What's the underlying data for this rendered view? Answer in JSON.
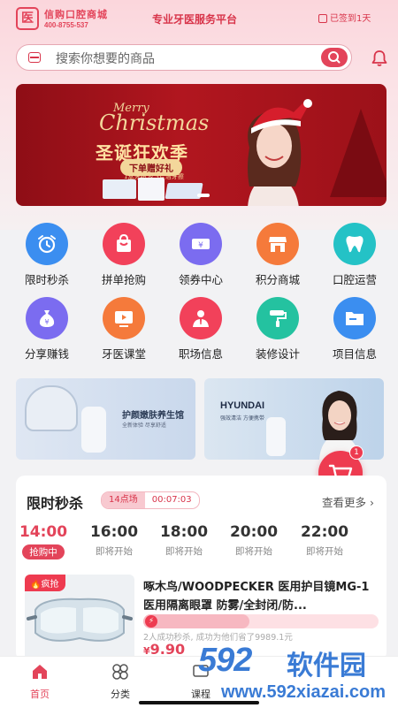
{
  "header": {
    "logo_name": "信购口腔商城",
    "logo_mark": "医",
    "logo_phone": "400-8755-537",
    "platform_title": "专业牙医服务平台",
    "signin_text": "已签到1天"
  },
  "search": {
    "placeholder": "搜索你想要的商品"
  },
  "banner": {
    "merry": "Merry",
    "christmas": "Christmas",
    "headline": "圣诞狂欢季",
    "gift": "下单赠好礼",
    "gift_desc": "1盒牙粉 & 5片洁牙擦"
  },
  "grid": {
    "row1": [
      {
        "label": "限时秒杀",
        "color": "#3b8ef0",
        "icon": "alarm-clock-icon"
      },
      {
        "label": "拼单抢购",
        "color": "#f2415a",
        "icon": "shopping-bag-icon"
      },
      {
        "label": "领券中心",
        "color": "#7b6cf0",
        "icon": "coupon-icon"
      },
      {
        "label": "积分商城",
        "color": "#f57a3b",
        "icon": "store-icon"
      },
      {
        "label": "口腔运营",
        "color": "#24c2c6",
        "icon": "tooth-icon"
      }
    ],
    "row2": [
      {
        "label": "分享赚钱",
        "color": "#7b6cf0",
        "icon": "money-bag-icon"
      },
      {
        "label": "牙医课堂",
        "color": "#f57a3b",
        "icon": "video-play-icon"
      },
      {
        "label": "职场信息",
        "color": "#f2415a",
        "icon": "person-card-icon"
      },
      {
        "label": "装修设计",
        "color": "#24c2a0",
        "icon": "paint-roller-icon"
      },
      {
        "label": "项目信息",
        "color": "#3b8ef0",
        "icon": "folder-icon"
      }
    ]
  },
  "promos": {
    "left_title": "护颜嫩肤养生馆",
    "left_sub": "全新体验 尽享舒适",
    "right_brand": "HYUNDAI",
    "right_sub": "强效清洁 方便携带"
  },
  "cart": {
    "badge": "1"
  },
  "flash": {
    "title": "限时秒杀",
    "slot": "14点场",
    "countdown": "00:07:03",
    "more": "查看更多",
    "times": [
      {
        "time": "14:00",
        "status": "抢购中",
        "active": true
      },
      {
        "time": "16:00",
        "status": "即将开始"
      },
      {
        "time": "18:00",
        "status": "即将开始"
      },
      {
        "time": "20:00",
        "status": "即将开始"
      },
      {
        "time": "22:00",
        "status": "即将开始"
      }
    ],
    "product": {
      "tag": "疯抢",
      "name": "啄木鸟/WOODPECKER 医用护目镜MG-1 医用隔离眼罩 防雾/全封闭/防...",
      "sold": "2人成功秒杀, 成功为他们省了9989.1元",
      "currency": "¥",
      "price": "9.90",
      "progress": 0.45
    }
  },
  "tabbar": [
    {
      "label": "首页",
      "icon": "home-icon",
      "active": true
    },
    {
      "label": "分类",
      "icon": "category-icon"
    },
    {
      "label": "课程",
      "icon": "course-icon"
    }
  ],
  "watermark": {
    "big": "592",
    "cn": "软件园",
    "url": "www.592xiazai.com"
  },
  "colors": {
    "accent": "#e3445a",
    "background": "#f2f2f4"
  }
}
